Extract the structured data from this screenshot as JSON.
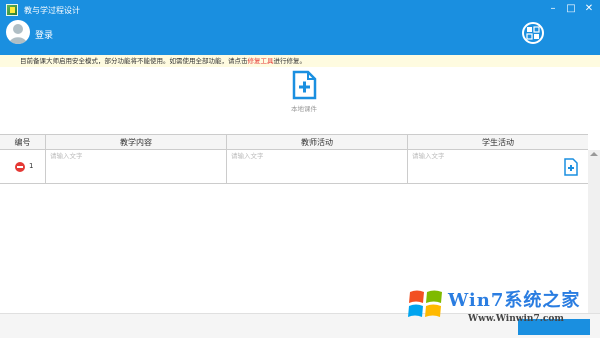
{
  "app": {
    "title": "教与学过程设计"
  },
  "user": {
    "login_label": "登录"
  },
  "notice": {
    "text_before": "目前备课大师启用安全模式，部分功能将不能使用。如需使用全部功能，请点击",
    "link": "修复工具",
    "text_after": "进行修复。"
  },
  "local_courseware": {
    "label": "本地课件"
  },
  "table": {
    "headers": [
      "编号",
      "教学内容",
      "教师活动",
      "学生活动"
    ],
    "rows": [
      {
        "number": "1",
        "placeholder": "请输入文字"
      }
    ]
  },
  "watermark": {
    "brand": "Win7系统之家",
    "url": "Www.Winwin7.com"
  },
  "colors": {
    "primary": "#1a8fe0",
    "notice_bg": "#fefbe0",
    "danger": "#e53935"
  },
  "icons": [
    "minimize-icon",
    "maximize-icon",
    "close-icon",
    "avatar-icon",
    "menu-grid-icon",
    "file-add-icon",
    "delete-icon"
  ]
}
